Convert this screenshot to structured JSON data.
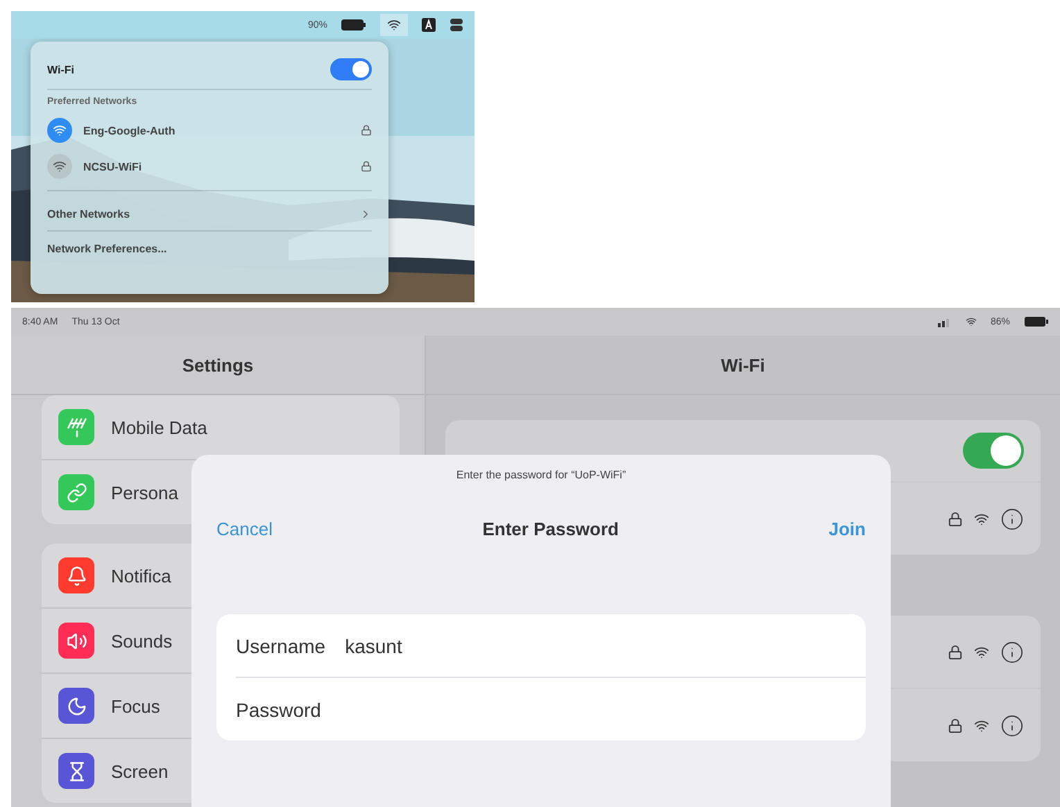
{
  "mac_menu_bar": {
    "battery": "90%"
  },
  "wifi_menu": {
    "title": "Wi-Fi",
    "on": true,
    "section": "Preferred Networks",
    "networks": [
      {
        "name": "Eng-Google-Auth",
        "selected": true,
        "locked": true
      },
      {
        "name": "NCSU-WiFi",
        "selected": false,
        "locked": true
      }
    ],
    "items": [
      {
        "label": "Other Networks",
        "kind": "submenu"
      },
      {
        "label": "Network Preferences...",
        "kind": "action"
      }
    ]
  },
  "ipad_status": {
    "time": "8:40 AM",
    "date": "Thu 13 Oct",
    "battery": "86%"
  },
  "sidebar": {
    "title": "Settings",
    "groups": [
      [
        {
          "label": "Mobile Data",
          "kind": "antenna",
          "color": "#34c759"
        },
        {
          "label": "Persona",
          "kind": "link",
          "color": "#34c759"
        }
      ],
      [
        {
          "label": "Notifica",
          "kind": "bell",
          "color": "#ff3b30"
        },
        {
          "label": "Sounds",
          "kind": "speaker",
          "color": "#ff2d55"
        },
        {
          "label": "Focus",
          "kind": "moon",
          "color": "#5856d6"
        },
        {
          "label": "Screen",
          "kind": "hourglass",
          "color": "#5856d6"
        }
      ]
    ]
  },
  "detail": {
    "title": "Wi-Fi",
    "wifi_on": true,
    "groups": [
      [
        {
          "locked": true
        }
      ],
      [
        {
          "locked": true
        },
        {
          "locked": true
        }
      ]
    ]
  },
  "dialog": {
    "prompt": "Enter the password for “UoP-WiFi”",
    "title": "Enter Password",
    "cancel": "Cancel",
    "join": "Join",
    "fields": [
      {
        "label": "Username",
        "value": "kasunt"
      },
      {
        "label": "Password"
      }
    ]
  }
}
